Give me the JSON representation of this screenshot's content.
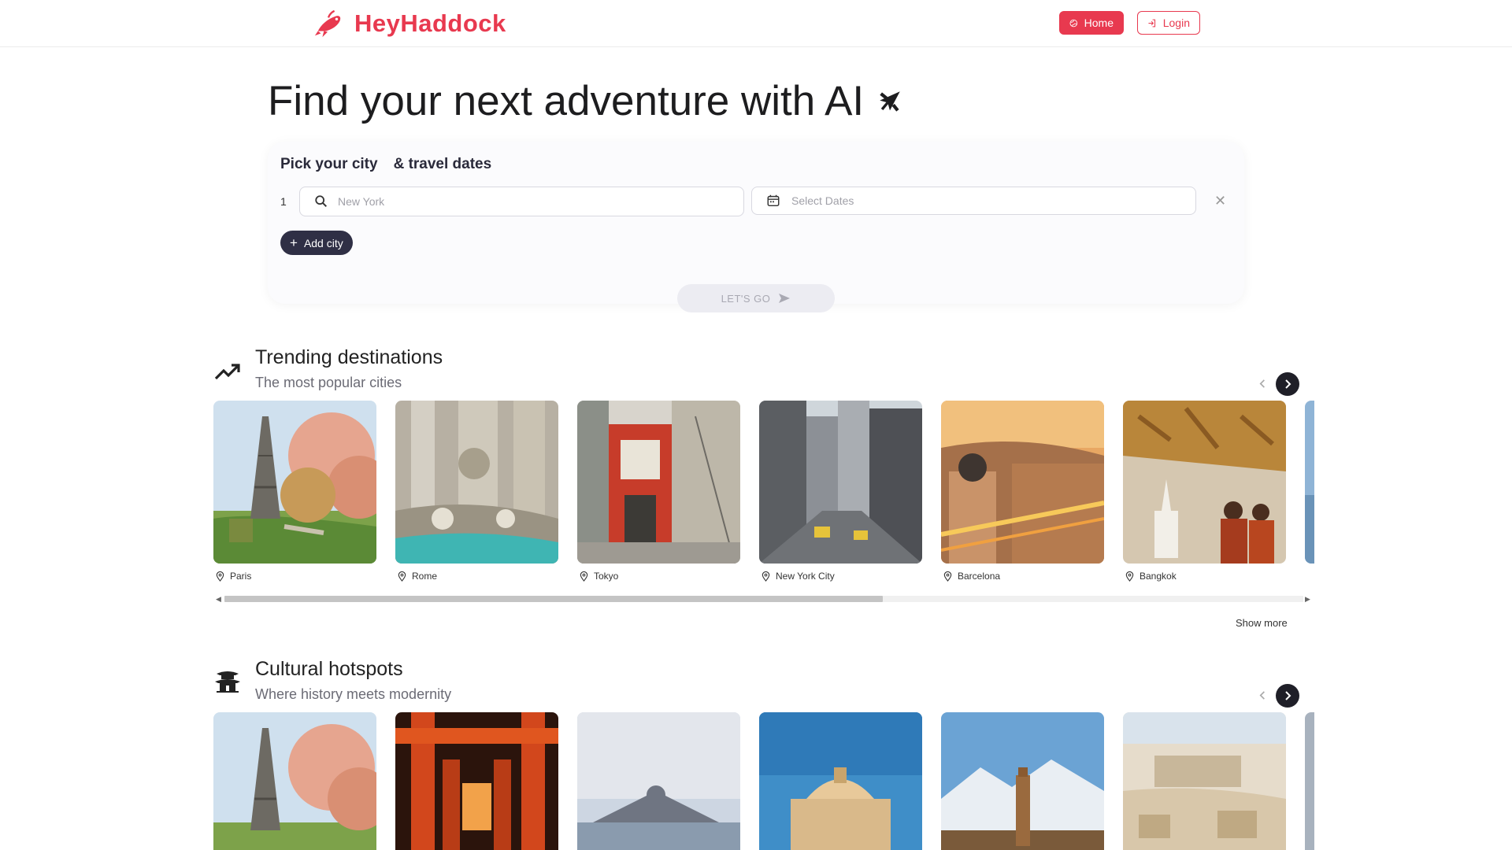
{
  "header": {
    "brand": "HeyHaddock",
    "logo_icon": "fish-icon",
    "nav": {
      "home_label": "Home",
      "login_label": "Login"
    },
    "brand_color": "#e8394f"
  },
  "hero": {
    "title": "Find your next adventure with AI",
    "icon": "airplane-icon"
  },
  "search": {
    "label_city": "Pick your city",
    "label_dates": "& travel dates",
    "row_number": "1",
    "city_placeholder": "New York",
    "dates_placeholder": "Select Dates",
    "clear_symbol": "✕",
    "add_city_label": "Add city",
    "submit_label": "LET'S GO"
  },
  "trending": {
    "title": "Trending destinations",
    "subtitle": "The most popular cities",
    "icon": "trending-up-icon",
    "cards": [
      {
        "city": "Paris"
      },
      {
        "city": "Rome"
      },
      {
        "city": "Tokyo"
      },
      {
        "city": "New York City"
      },
      {
        "city": "Barcelona"
      },
      {
        "city": "Bangkok"
      }
    ],
    "show_more": "Show more"
  },
  "cultural": {
    "title": "Cultural hotspots",
    "subtitle": "Where history meets modernity",
    "icon": "pagoda-icon",
    "card_count_visible": 6
  }
}
